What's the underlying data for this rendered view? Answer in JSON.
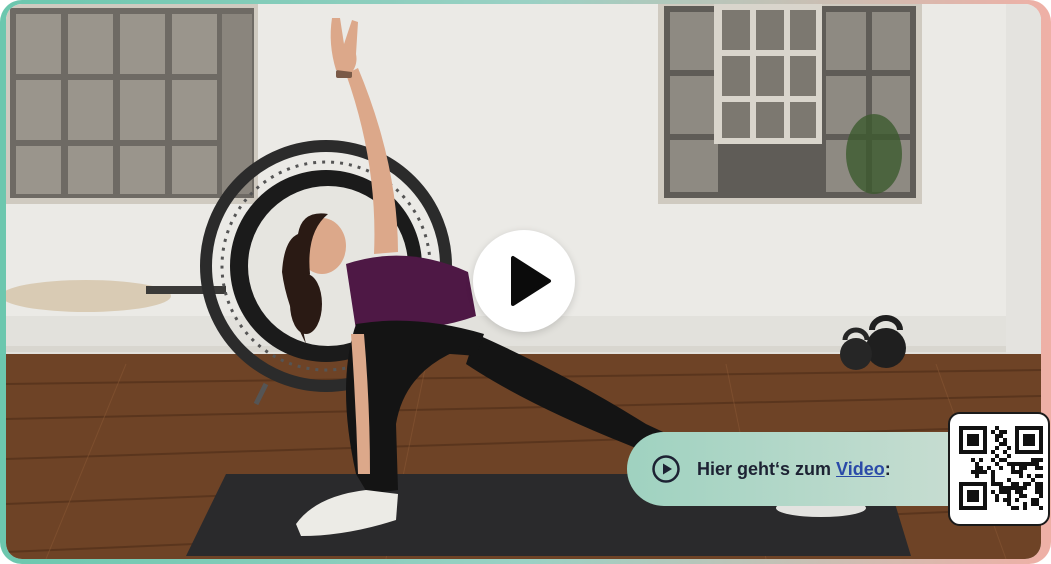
{
  "video": {
    "play_button_label": "",
    "play_icon": "play-triangle-icon"
  },
  "cta": {
    "icon": "play-circle-icon",
    "text_prefix": "Hier geht‘s zum ",
    "link_text": "Video",
    "text_suffix": ":"
  },
  "qr": {
    "icon": "qr-code-icon"
  },
  "colors": {
    "frame_left": "#6cc7ae",
    "frame_right": "#efb0a6",
    "cta_bg": "#a8d5c5",
    "link": "#2a4aa8",
    "text_dark": "#1d2233"
  }
}
